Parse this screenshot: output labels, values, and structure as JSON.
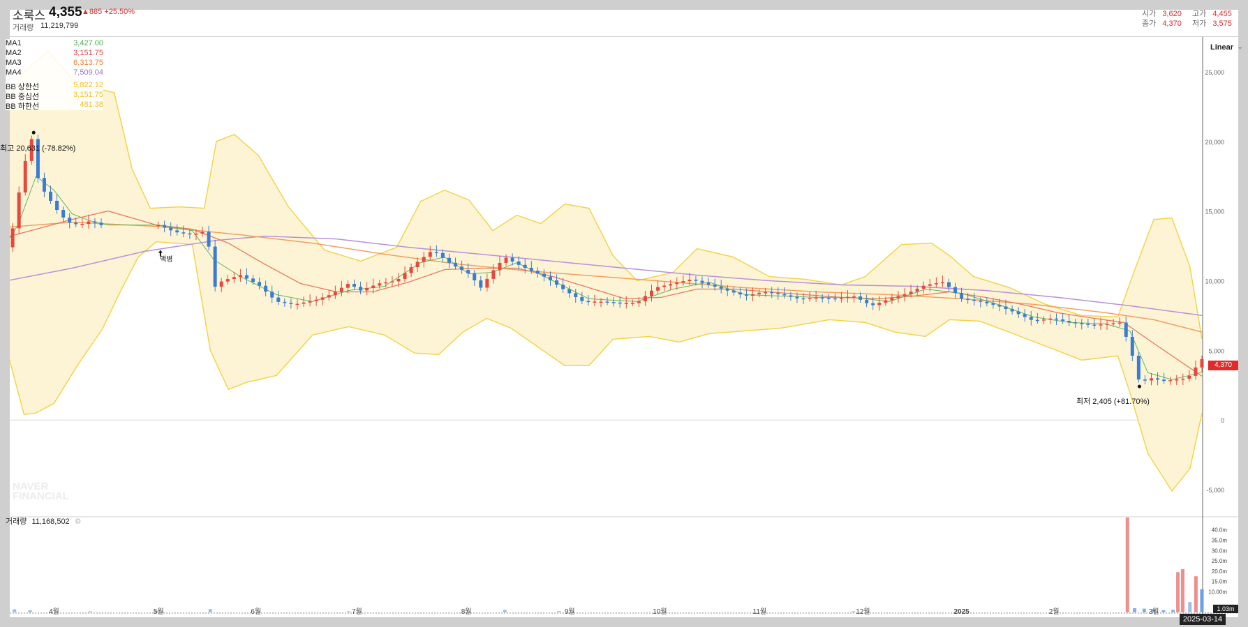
{
  "header": {
    "stock_name": "소룩스",
    "price": "4,355",
    "change": "▲885 +25.50%",
    "volume_label": "거래량",
    "volume_value": "11,219,799",
    "open_label": "시가",
    "open_value": "3,620",
    "high_label": "고가",
    "high_value": "4,455",
    "close_label": "종가",
    "close_value": "4,370",
    "low_label": "저가",
    "low_value": "3,575"
  },
  "legend": [
    {
      "name": "MA1",
      "value": "3,427.00",
      "color": "#4caf50"
    },
    {
      "name": "MA2",
      "value": "3,151.75",
      "color": "#e04040"
    },
    {
      "name": "MA3",
      "value": "6,313.75",
      "color": "#f08030"
    },
    {
      "name": "MA4",
      "value": "7,509.04",
      "color": "#a070d0"
    },
    {
      "name": "BB 상한선",
      "value": "5,822.12",
      "color": "#f0c020"
    },
    {
      "name": "BB 중심선",
      "value": "3,151.75",
      "color": "#f0c020"
    },
    {
      "name": "BB 하한선",
      "value": "481.38",
      "color": "#f0c020"
    }
  ],
  "scale_mode": "Linear",
  "annotations": {
    "high": "최고 20,631 (-78.82%)",
    "low": "최저 2,405 (+81.70%)",
    "split": "액병"
  },
  "volume_panel": {
    "label": "거래량",
    "value": "11,168,502"
  },
  "watermark": [
    "NAVER",
    "FINANCIAL"
  ],
  "current_price_tag": "4,370",
  "current_volume_tag": "1.03m",
  "date_badge": "2025-03-14",
  "colors": {
    "up": "#e8473e",
    "down": "#3a7bd5",
    "band_fill": "#fdf4d6",
    "band_line": "#f3d44a"
  },
  "chart_data": {
    "type": "candlestick",
    "price_axis": {
      "ticks": [
        -5000,
        0,
        5000,
        10000,
        15000,
        20000,
        25000
      ],
      "tick_labels": [
        "-5,000",
        "0",
        "5,000",
        "10,000",
        "15,000",
        "20,000",
        "25,000"
      ],
      "ylim": [
        -6500,
        27500
      ]
    },
    "volume_axis": {
      "ticks": [
        10,
        15,
        20,
        25,
        30,
        35,
        40
      ],
      "tick_labels": [
        "10.00m",
        "15.0m",
        "20.0m",
        "25.0m",
        "30.0m",
        "35.0m",
        "40.0m"
      ],
      "unit": "m",
      "ylim": [
        0,
        47
      ]
    },
    "x_labels": [
      {
        "label": "4월",
        "pos": 0.045
      },
      {
        "label": "5월",
        "pos": 0.132
      },
      {
        "label": "6월",
        "pos": 0.213
      },
      {
        "label": "7월",
        "pos": 0.297
      },
      {
        "label": "8월",
        "pos": 0.388
      },
      {
        "label": "9월",
        "pos": 0.474
      },
      {
        "label": "10월",
        "pos": 0.549
      },
      {
        "label": "11월",
        "pos": 0.632
      },
      {
        "label": "12월",
        "pos": 0.718
      },
      {
        "label": "2025",
        "pos": 0.8
      },
      {
        "label": "2월",
        "pos": 0.877
      },
      {
        "label": "3월",
        "pos": 0.96
      }
    ],
    "price_path": [
      [
        0.0,
        12200
      ],
      [
        0.008,
        12500
      ],
      [
        0.015,
        16000
      ],
      [
        0.022,
        19000
      ],
      [
        0.028,
        20631
      ],
      [
        0.032,
        17000
      ],
      [
        0.04,
        16000
      ],
      [
        0.048,
        15000
      ],
      [
        0.056,
        14200
      ],
      [
        0.066,
        14000
      ],
      [
        0.075,
        14300
      ],
      [
        0.09,
        13800
      ],
      [
        0.132,
        14000
      ],
      [
        0.145,
        13500
      ],
      [
        0.16,
        13300
      ],
      [
        0.172,
        13600
      ],
      [
        0.178,
        9500
      ],
      [
        0.185,
        10000
      ],
      [
        0.2,
        10400
      ],
      [
        0.215,
        9700
      ],
      [
        0.23,
        8500
      ],
      [
        0.245,
        8300
      ],
      [
        0.262,
        8600
      ],
      [
        0.275,
        9000
      ],
      [
        0.29,
        9800
      ],
      [
        0.3,
        9300
      ],
      [
        0.315,
        9800
      ],
      [
        0.33,
        10000
      ],
      [
        0.345,
        11200
      ],
      [
        0.36,
        12200
      ],
      [
        0.375,
        11200
      ],
      [
        0.39,
        10500
      ],
      [
        0.4,
        9500
      ],
      [
        0.41,
        10700
      ],
      [
        0.42,
        11700
      ],
      [
        0.43,
        11200
      ],
      [
        0.44,
        10800
      ],
      [
        0.455,
        10200
      ],
      [
        0.47,
        9300
      ],
      [
        0.485,
        8500
      ],
      [
        0.5,
        8500
      ],
      [
        0.515,
        8400
      ],
      [
        0.53,
        8400
      ],
      [
        0.545,
        9500
      ],
      [
        0.56,
        9800
      ],
      [
        0.575,
        10100
      ],
      [
        0.59,
        9700
      ],
      [
        0.605,
        9300
      ],
      [
        0.62,
        8900
      ],
      [
        0.635,
        9200
      ],
      [
        0.65,
        9000
      ],
      [
        0.665,
        8700
      ],
      [
        0.68,
        8800
      ],
      [
        0.695,
        8700
      ],
      [
        0.71,
        8900
      ],
      [
        0.725,
        8200
      ],
      [
        0.74,
        8700
      ],
      [
        0.755,
        9100
      ],
      [
        0.77,
        9700
      ],
      [
        0.785,
        9900
      ],
      [
        0.8,
        8700
      ],
      [
        0.815,
        8500
      ],
      [
        0.83,
        8200
      ],
      [
        0.845,
        7700
      ],
      [
        0.86,
        7100
      ],
      [
        0.875,
        7300
      ],
      [
        0.89,
        7000
      ],
      [
        0.9,
        6900
      ],
      [
        0.91,
        6800
      ],
      [
        0.92,
        6900
      ],
      [
        0.932,
        7000
      ],
      [
        0.94,
        5300
      ],
      [
        0.948,
        2700
      ],
      [
        0.958,
        3000
      ],
      [
        0.968,
        2800
      ],
      [
        0.978,
        2900
      ],
      [
        0.988,
        3000
      ],
      [
        1.0,
        4370
      ]
    ],
    "ma_short": [
      [
        0.0,
        12000
      ],
      [
        0.015,
        14000
      ],
      [
        0.03,
        17500
      ],
      [
        0.045,
        16500
      ],
      [
        0.06,
        14800
      ],
      [
        0.075,
        14300
      ],
      [
        0.09,
        14000
      ],
      [
        0.132,
        14000
      ],
      [
        0.16,
        13600
      ],
      [
        0.178,
        11500
      ],
      [
        0.2,
        10300
      ],
      [
        0.23,
        9000
      ],
      [
        0.26,
        8500
      ],
      [
        0.29,
        9300
      ],
      [
        0.32,
        9600
      ],
      [
        0.35,
        11300
      ],
      [
        0.37,
        11700
      ],
      [
        0.39,
        10500
      ],
      [
        0.41,
        10600
      ],
      [
        0.43,
        11300
      ],
      [
        0.46,
        10000
      ],
      [
        0.49,
        8700
      ],
      [
        0.53,
        8500
      ],
      [
        0.56,
        9400
      ],
      [
        0.59,
        9900
      ],
      [
        0.62,
        9000
      ],
      [
        0.65,
        8900
      ],
      [
        0.68,
        8800
      ],
      [
        0.71,
        8800
      ],
      [
        0.74,
        8500
      ],
      [
        0.77,
        9400
      ],
      [
        0.8,
        9100
      ],
      [
        0.83,
        8300
      ],
      [
        0.86,
        7400
      ],
      [
        0.89,
        7000
      ],
      [
        0.92,
        6900
      ],
      [
        0.94,
        6400
      ],
      [
        0.955,
        3400
      ],
      [
        0.975,
        2900
      ],
      [
        1.0,
        3427
      ]
    ],
    "ma_mid": [
      [
        0.0,
        13000
      ],
      [
        0.03,
        13700
      ],
      [
        0.06,
        14400
      ],
      [
        0.09,
        15000
      ],
      [
        0.13,
        14000
      ],
      [
        0.16,
        13700
      ],
      [
        0.19,
        12700
      ],
      [
        0.22,
        11200
      ],
      [
        0.25,
        9800
      ],
      [
        0.28,
        9200
      ],
      [
        0.31,
        9200
      ],
      [
        0.34,
        9900
      ],
      [
        0.37,
        10800
      ],
      [
        0.4,
        10900
      ],
      [
        0.43,
        10900
      ],
      [
        0.46,
        10300
      ],
      [
        0.49,
        9500
      ],
      [
        0.52,
        8700
      ],
      [
        0.55,
        8800
      ],
      [
        0.58,
        9400
      ],
      [
        0.61,
        9400
      ],
      [
        0.64,
        9200
      ],
      [
        0.67,
        9000
      ],
      [
        0.7,
        8800
      ],
      [
        0.73,
        8700
      ],
      [
        0.76,
        8900
      ],
      [
        0.79,
        9200
      ],
      [
        0.82,
        8800
      ],
      [
        0.85,
        8300
      ],
      [
        0.88,
        7700
      ],
      [
        0.91,
        7300
      ],
      [
        0.935,
        7000
      ],
      [
        0.96,
        5500
      ],
      [
        1.0,
        3151
      ]
    ],
    "ma_long": [
      [
        0.0,
        13800
      ],
      [
        0.06,
        14200
      ],
      [
        0.13,
        13900
      ],
      [
        0.2,
        13300
      ],
      [
        0.26,
        12700
      ],
      [
        0.32,
        11900
      ],
      [
        0.38,
        11200
      ],
      [
        0.44,
        10700
      ],
      [
        0.5,
        10300
      ],
      [
        0.56,
        9900
      ],
      [
        0.62,
        9500
      ],
      [
        0.68,
        9200
      ],
      [
        0.74,
        9000
      ],
      [
        0.8,
        8700
      ],
      [
        0.86,
        8300
      ],
      [
        0.92,
        7700
      ],
      [
        0.96,
        7200
      ],
      [
        1.0,
        6313
      ]
    ],
    "ma_year": [
      [
        0.0,
        9900
      ],
      [
        0.06,
        10900
      ],
      [
        0.12,
        12100
      ],
      [
        0.18,
        12900
      ],
      [
        0.22,
        13200
      ],
      [
        0.28,
        13000
      ],
      [
        0.34,
        12400
      ],
      [
        0.4,
        11900
      ],
      [
        0.46,
        11400
      ],
      [
        0.52,
        10900
      ],
      [
        0.58,
        10400
      ],
      [
        0.64,
        10000
      ],
      [
        0.7,
        9700
      ],
      [
        0.76,
        9600
      ],
      [
        0.82,
        9300
      ],
      [
        0.88,
        8800
      ],
      [
        0.94,
        8200
      ],
      [
        1.0,
        7509
      ]
    ],
    "bb_upper": [
      [
        0.0,
        22000
      ],
      [
        0.02,
        25000
      ],
      [
        0.04,
        26500
      ],
      [
        0.06,
        24500
      ],
      [
        0.08,
        23800
      ],
      [
        0.095,
        23500
      ],
      [
        0.11,
        18000
      ],
      [
        0.125,
        15200
      ],
      [
        0.15,
        15300
      ],
      [
        0.17,
        15200
      ],
      [
        0.18,
        20000
      ],
      [
        0.195,
        20500
      ],
      [
        0.215,
        19000
      ],
      [
        0.24,
        15300
      ],
      [
        0.27,
        12200
      ],
      [
        0.3,
        11400
      ],
      [
        0.33,
        12400
      ],
      [
        0.35,
        15700
      ],
      [
        0.37,
        16500
      ],
      [
        0.39,
        15800
      ],
      [
        0.41,
        13600
      ],
      [
        0.43,
        14700
      ],
      [
        0.45,
        14100
      ],
      [
        0.47,
        15500
      ],
      [
        0.49,
        15200
      ],
      [
        0.51,
        11800
      ],
      [
        0.53,
        10000
      ],
      [
        0.56,
        10600
      ],
      [
        0.58,
        12300
      ],
      [
        0.61,
        11700
      ],
      [
        0.64,
        10300
      ],
      [
        0.67,
        10100
      ],
      [
        0.7,
        9700
      ],
      [
        0.72,
        10300
      ],
      [
        0.75,
        12600
      ],
      [
        0.775,
        12700
      ],
      [
        0.79,
        11800
      ],
      [
        0.81,
        10300
      ],
      [
        0.84,
        9500
      ],
      [
        0.87,
        8300
      ],
      [
        0.9,
        7500
      ],
      [
        0.93,
        7400
      ],
      [
        0.945,
        11000
      ],
      [
        0.96,
        14400
      ],
      [
        0.975,
        14500
      ],
      [
        0.99,
        11000
      ],
      [
        1.0,
        5822
      ]
    ],
    "bb_lower": [
      [
        0.0,
        6900
      ],
      [
        0.02,
        400
      ],
      [
        0.03,
        500
      ],
      [
        0.045,
        1200
      ],
      [
        0.065,
        4000
      ],
      [
        0.085,
        6500
      ],
      [
        0.1,
        9200
      ],
      [
        0.115,
        11700
      ],
      [
        0.13,
        12800
      ],
      [
        0.16,
        12600
      ],
      [
        0.175,
        5000
      ],
      [
        0.19,
        2200
      ],
      [
        0.205,
        2700
      ],
      [
        0.23,
        3200
      ],
      [
        0.26,
        6100
      ],
      [
        0.29,
        6700
      ],
      [
        0.32,
        6100
      ],
      [
        0.345,
        4800
      ],
      [
        0.365,
        4700
      ],
      [
        0.385,
        6300
      ],
      [
        0.405,
        7300
      ],
      [
        0.425,
        6600
      ],
      [
        0.445,
        5400
      ],
      [
        0.47,
        3900
      ],
      [
        0.49,
        3900
      ],
      [
        0.51,
        5800
      ],
      [
        0.54,
        6000
      ],
      [
        0.565,
        5600
      ],
      [
        0.59,
        6200
      ],
      [
        0.62,
        6400
      ],
      [
        0.65,
        6600
      ],
      [
        0.69,
        7200
      ],
      [
        0.72,
        7000
      ],
      [
        0.745,
        6300
      ],
      [
        0.77,
        6000
      ],
      [
        0.79,
        7200
      ],
      [
        0.815,
        7100
      ],
      [
        0.84,
        6300
      ],
      [
        0.87,
        5300
      ],
      [
        0.9,
        4300
      ],
      [
        0.93,
        4600
      ],
      [
        0.94,
        2000
      ],
      [
        0.955,
        -2400
      ],
      [
        0.975,
        -5100
      ],
      [
        0.99,
        -3500
      ],
      [
        1.0,
        481
      ]
    ],
    "volume_m": [
      [
        0.012,
        1.5
      ],
      [
        0.025,
        1.0
      ],
      [
        0.075,
        0.5
      ],
      [
        0.13,
        0.8
      ],
      [
        0.175,
        1.6
      ],
      [
        0.29,
        0.5
      ],
      [
        0.42,
        1.2
      ],
      [
        0.465,
        0.6
      ],
      [
        0.71,
        0.5
      ],
      [
        0.8,
        0.4
      ],
      [
        0.938,
        46.0
      ],
      [
        0.944,
        2.0
      ],
      [
        0.952,
        1.8
      ],
      [
        0.96,
        1.5
      ],
      [
        0.968,
        1.0
      ],
      [
        0.976,
        1.2
      ],
      [
        0.98,
        19.5
      ],
      [
        0.984,
        21.0
      ],
      [
        0.99,
        5.0
      ],
      [
        0.995,
        17.5
      ],
      [
        1.0,
        11.2
      ]
    ]
  }
}
